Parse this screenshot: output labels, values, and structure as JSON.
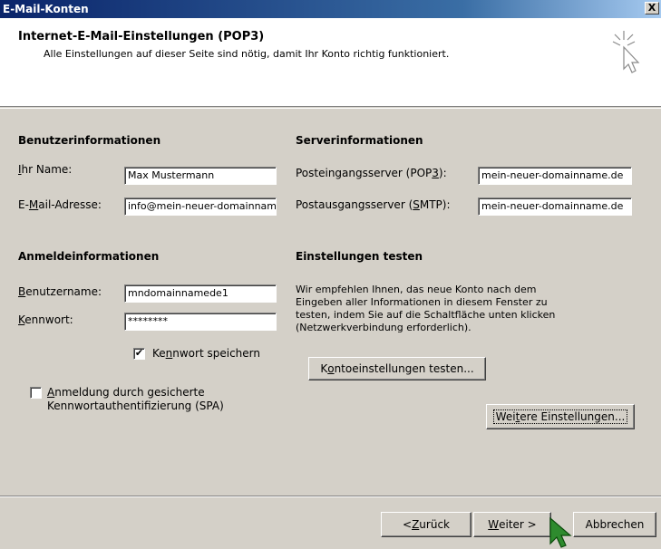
{
  "window": {
    "title": "E-Mail-Konten",
    "close": "X"
  },
  "header": {
    "title": "Internet-E-Mail-Einstellungen (POP3)",
    "subtitle": "Alle Einstellungen auf dieser Seite sind nötig, damit Ihr Konto richtig funktioniert."
  },
  "user": {
    "heading": "Benutzerinformationen",
    "name_label": [
      "",
      "I",
      "hr Name:"
    ],
    "name_value": "Max Mustermann",
    "email_label": [
      "E-",
      "M",
      "ail-Adresse:"
    ],
    "email_value": "info@mein-neuer-domainname.de"
  },
  "server": {
    "heading": "Serverinformationen",
    "incoming_label": [
      "Posteingangsserver (POP",
      "3",
      "):"
    ],
    "incoming_value": "mein-neuer-domainname.de",
    "outgoing_label": [
      "Postausgangsserver (",
      "S",
      "MTP):"
    ],
    "outgoing_value": "mein-neuer-domainname.de"
  },
  "login": {
    "heading": "Anmeldeinformationen",
    "username_label": [
      "",
      "B",
      "enutzername:"
    ],
    "username_value": "mndomainnamede1",
    "password_label": [
      "",
      "K",
      "ennwort:"
    ],
    "password_value": "********",
    "remember_label": [
      "Ke",
      "n",
      "nwort speichern"
    ],
    "remember_checked": "✔",
    "spa_label": [
      "",
      "A",
      "nmeldung durch gesicherte"
    ],
    "spa_label2": "Kennwortauthentifizierung (SPA)"
  },
  "test": {
    "heading": "Einstellungen testen",
    "description": [
      "Wir empfehlen Ihnen, das neue Konto nach dem",
      "Eingeben aller Informationen in diesem Fenster zu",
      "testen, indem Sie auf die Schaltfläche unten klicken",
      "(Netzwerkverbindung erforderlich)."
    ],
    "test_button": [
      "K",
      "o",
      "ntoeinstellungen testen..."
    ],
    "more_button": [
      "Wei",
      "t",
      "ere Einstellungen..."
    ]
  },
  "footer": {
    "back": [
      "< ",
      "Z",
      "urück"
    ],
    "next": [
      "",
      "W",
      "eiter >"
    ],
    "cancel": "Abbrechen"
  }
}
